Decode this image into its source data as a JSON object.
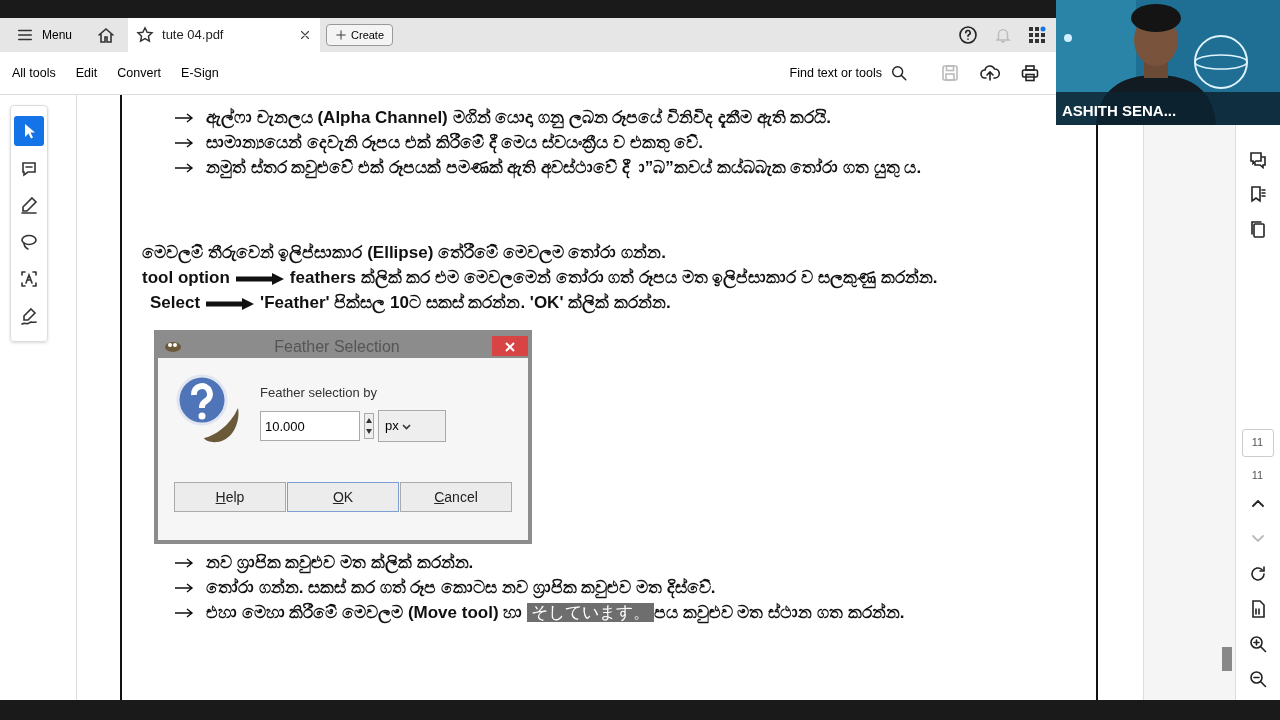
{
  "tab_bar": {
    "menu": "Menu",
    "tab_title": "tute 04.pdf",
    "create": "Create"
  },
  "toolbar": {
    "items": [
      "All tools",
      "Edit",
      "Convert",
      "E-Sign"
    ],
    "search": "Find text or tools",
    "icons": [
      {
        "kind": "save",
        "disabled": true
      },
      {
        "kind": "upload",
        "disabled": false
      },
      {
        "kind": "print",
        "disabled": false
      }
    ]
  },
  "left_tools": [
    {
      "kind": "select",
      "selected": true
    },
    {
      "kind": "comment",
      "selected": false
    },
    {
      "kind": "pen",
      "selected": false
    },
    {
      "kind": "lasso",
      "selected": false
    },
    {
      "kind": "textselect",
      "selected": false
    },
    {
      "kind": "sign",
      "selected": false
    }
  ],
  "document": {
    "bullets_top": [
      "ඇල්ෆා චැනලය **(Alpha Channel)** මගින් යොදා ගනු ලබන රූපයේ විනිවිද දැකීම ඇති කරයි.",
      "සාමාන්‍යයෙන් දෙවැනි රූපය එක් කිරීමේ දී මෙය ස්වයංක්‍රීය ව එකතු වේ.",
      "නමුත් ස්තර කවුළුවේ එක් රූපයක් පමණක් ඇති අවස්ථාවේ දී ා”බ”කවය් කය්බබැක තෝරා ගත යුතු ය."
    ],
    "paragraph": "මෙවලම් තීරුවෙන් ඉලිප්සාකාර **(Ellipse)** තේරීමේ මෙවලම තෝරා ගන්න.",
    "steps": [
      {
        "lead": "tool option",
        "text": "**feathers** ක්ලික් කර එම මෙවලමෙන් තෝරා ගත් රූපය මත ඉලිප්සාකාර ව සලකුණු කරන්න."
      },
      {
        "lead": "Select",
        "text": "**'Feather'** පික්සල 10ට සකස් කරන්න. **'OK'** ක්ලික් කරන්න."
      }
    ],
    "dialog": {
      "title": "Feather Selection",
      "label": "Feather selection by",
      "value": "10.000",
      "unit": "px",
      "buttons": [
        {
          "label": "Help",
          "default": false
        },
        {
          "label": "OK",
          "default": true
        },
        {
          "label": "Cancel",
          "default": false
        }
      ]
    },
    "bullets_bottom": [
      "නව ග්‍රාපික කවුළුව මත ක්ලික් කරන්න.",
      "තෝරා ගන්න. සකස් කර ගත් රූප කොටස නව ග්‍රාපික කවුළුව මත දිස්වේ."
    ],
    "last_line": {
      "before": "එහා මෙහා කිරීමේ මෙවලම **(Move tool)** හා",
      "caption": "そしています。",
      "after": "පය කවුළුව මත ස්ථාන ගත කරන්න."
    }
  },
  "right_rail": {
    "page_box": "11",
    "page_label": "11",
    "nav": [
      {
        "kind": "up",
        "disabled": false
      },
      {
        "kind": "down",
        "disabled": true
      }
    ]
  },
  "video": {
    "name": "ASHITH SENA..."
  }
}
